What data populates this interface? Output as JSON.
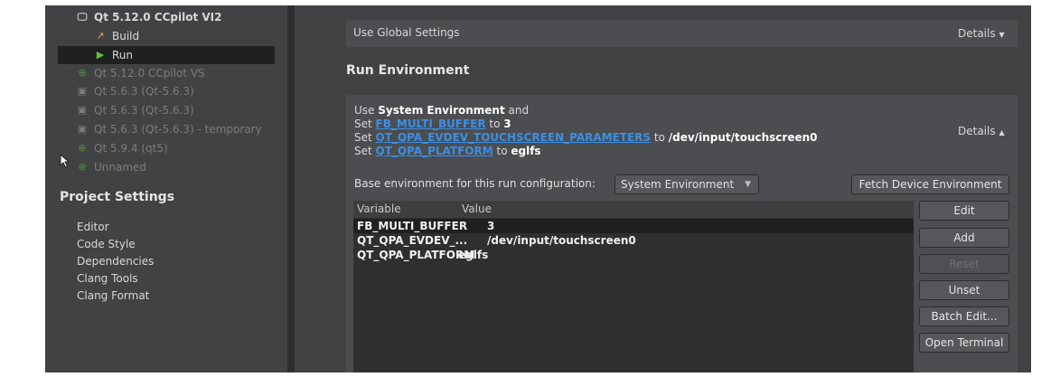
{
  "sidebar": {
    "tree": [
      {
        "icon": "monitor-icon",
        "label": "Qt 5.12.0 CCpilot VI2",
        "dim": false,
        "bold": true
      },
      {
        "icon": "hammer-icon",
        "label": "Build",
        "dim": false
      },
      {
        "icon": "play-icon",
        "label": "Run",
        "dim": false,
        "selected": true
      },
      {
        "icon": "kit-add-icon",
        "label": "Qt 5.12.0 CCpilot VS",
        "dim": true
      },
      {
        "icon": "kit-icon",
        "label": "Qt 5.6.3 (Qt-5.6.3)",
        "dim": true
      },
      {
        "icon": "kit-icon",
        "label": "Qt 5.6.3 (Qt-5.6.3)",
        "dim": true
      },
      {
        "icon": "kit-icon",
        "label": "Qt 5.6.3 (Qt-5.6.3) - temporary",
        "dim": true
      },
      {
        "icon": "kit-add-icon",
        "label": "Qt 5.9.4 (qt5)",
        "dim": true
      },
      {
        "icon": "kit-add-icon",
        "label": "Unnamed",
        "dim": true
      }
    ],
    "project_settings_title": "Project Settings",
    "settings_items": [
      "Editor",
      "Code Style",
      "Dependencies",
      "Clang Tools",
      "Clang Format"
    ]
  },
  "main": {
    "global_settings_label": "Use Global Settings",
    "details_collapsed": "Details",
    "run_env_title": "Run Environment",
    "env_summary": {
      "line1_prefix": "Use ",
      "line1_bold": "System Environment",
      "line1_suffix": " and",
      "set_word": "Set ",
      "to_word": " to ",
      "vars": [
        {
          "name": "FB_MULTI_BUFFER",
          "value": "3"
        },
        {
          "name": "QT_QPA_EVDEV_TOUCHSCREEN_PARAMETERS",
          "value": "/dev/input/touchscreen0"
        },
        {
          "name": "QT_QPA_PLATFORM",
          "value": "eglfs"
        }
      ]
    },
    "details_expanded": "Details",
    "base_env_label": "Base environment for this run configuration:",
    "base_env_value": "System Environment",
    "fetch_button": "Fetch Device Environment",
    "table": {
      "headers": [
        "Variable",
        "Value"
      ],
      "rows": [
        {
          "variable": "FB_MULTI_BUFFER",
          "value": "3"
        },
        {
          "variable": "QT_QPA_EVDEV_...",
          "value": "/dev/input/touchscreen0"
        },
        {
          "variable": "QT_QPA_PLATFORM",
          "value": "eglfs"
        }
      ]
    },
    "buttons": {
      "edit": "Edit",
      "add": "Add",
      "reset": "Reset",
      "unset": "Unset",
      "batch_edit": "Batch Edit...",
      "open_terminal": "Open Terminal"
    }
  }
}
